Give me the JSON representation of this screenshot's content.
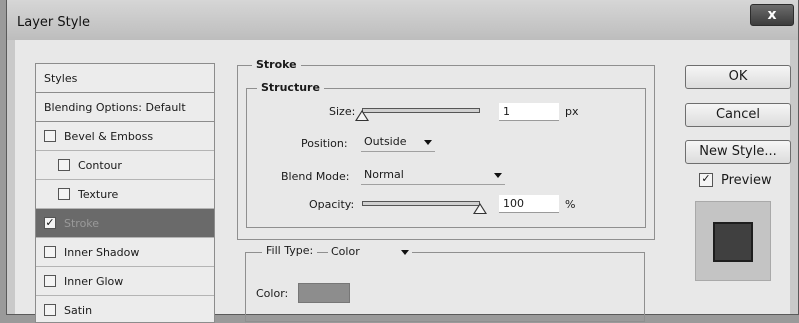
{
  "window": {
    "title": "Layer Style",
    "close_glyph": "x"
  },
  "style_list": {
    "items": [
      {
        "label": "Styles",
        "checkbox": false,
        "checked": false,
        "indent": false,
        "selected": false,
        "header": true
      },
      {
        "label": "Blending Options: Default",
        "checkbox": false,
        "checked": false,
        "indent": false,
        "selected": false,
        "header": true
      },
      {
        "label": "Bevel & Emboss",
        "checkbox": true,
        "checked": false,
        "indent": false,
        "selected": false
      },
      {
        "label": "Contour",
        "checkbox": true,
        "checked": false,
        "indent": true,
        "selected": false
      },
      {
        "label": "Texture",
        "checkbox": true,
        "checked": false,
        "indent": true,
        "selected": false
      },
      {
        "label": "Stroke",
        "checkbox": true,
        "checked": true,
        "indent": false,
        "selected": true
      },
      {
        "label": "Inner Shadow",
        "checkbox": true,
        "checked": false,
        "indent": false,
        "selected": false
      },
      {
        "label": "Inner Glow",
        "checkbox": true,
        "checked": false,
        "indent": false,
        "selected": false
      },
      {
        "label": "Satin",
        "checkbox": true,
        "checked": false,
        "indent": false,
        "selected": false
      }
    ]
  },
  "stroke": {
    "heading": "Stroke",
    "structure_heading": "Structure",
    "size_label": "Size:",
    "size_value": "1",
    "size_unit": "px",
    "size_level": 0.0,
    "position_label": "Position:",
    "position_value": "Outside",
    "blend_label": "Blend Mode:",
    "blend_value": "Normal",
    "opacity_label": "Opacity:",
    "opacity_value": "100",
    "opacity_unit": "%",
    "opacity_level": 1.0,
    "fill_type_label": "Fill Type:",
    "fill_type_value": "Color",
    "color_label": "Color:",
    "color_swatch": "#8d8d8d"
  },
  "buttons": {
    "ok": "OK",
    "cancel": "Cancel",
    "new_style": "New Style...",
    "preview_label": "Preview",
    "preview_checked": true,
    "preview_color": "#404040"
  }
}
